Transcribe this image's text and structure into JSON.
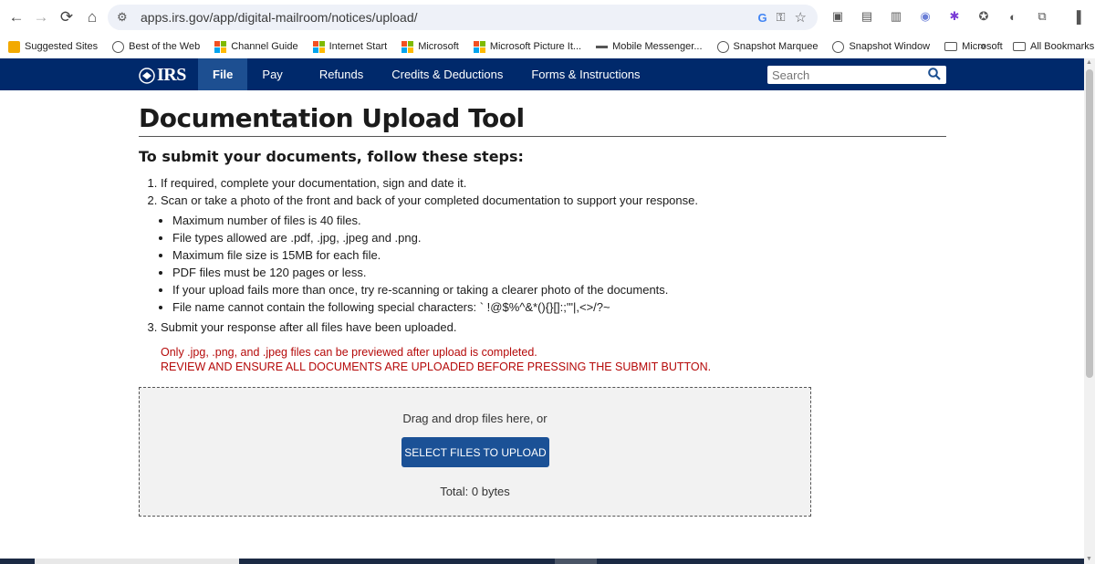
{
  "browser": {
    "url": "apps.irs.gov/app/digital-mailroom/notices/upload/",
    "bookmarks": [
      {
        "label": "Suggested Sites",
        "icon": "bing-icon"
      },
      {
        "label": "Best of the Web",
        "icon": "globe-icon"
      },
      {
        "label": "Channel Guide",
        "icon": "microsoft-icon"
      },
      {
        "label": "Internet Start",
        "icon": "microsoft-icon"
      },
      {
        "label": "Microsoft",
        "icon": "microsoft-icon"
      },
      {
        "label": "Microsoft Picture It...",
        "icon": "microsoft-icon"
      },
      {
        "label": "Mobile Messenger...",
        "icon": "messenger-icon"
      },
      {
        "label": "Snapshot Marquee",
        "icon": "globe-icon"
      },
      {
        "label": "Snapshot Window",
        "icon": "globe-icon"
      },
      {
        "label": "Microsoft",
        "icon": "folder-icon"
      }
    ],
    "overflow_chevron": "»",
    "all_bookmarks": "All Bookmarks"
  },
  "irs": {
    "logo": "IRS",
    "nav": [
      {
        "label": "File",
        "active": true
      },
      {
        "label": "Pay",
        "active": false
      },
      {
        "label": "Refunds",
        "active": false
      },
      {
        "label": "Credits & Deductions",
        "active": false
      },
      {
        "label": "Forms & Instructions",
        "active": false
      }
    ],
    "search_placeholder": "Search"
  },
  "page": {
    "title": "Documentation Upload Tool",
    "subtitle": "To submit your documents, follow these steps:",
    "step1": "If required, complete your documentation, sign and date it.",
    "step2": "Scan or take a photo of the front and back of your completed documentation to support your response.",
    "bullets": [
      "Maximum number of files is 40 files.",
      "File types allowed are .pdf, .jpg, .jpeg and .png.",
      "Maximum file size is 15MB for each file.",
      "PDF files must be 120 pages or less.",
      "If your upload fails more than once, try re-scanning or taking a clearer photo of the documents.",
      "File name cannot contain the following special characters: ` !@$%^&*(){}[]:;'\"|,<>/?~"
    ],
    "step3": "Submit your response after all files have been uploaded.",
    "notice_line1": "Only .jpg, .png, and .jpeg files can be previewed after upload is completed.",
    "notice_line2": "REVIEW AND ENSURE ALL DOCUMENTS ARE UPLOADED BEFORE PRESSING THE SUBMIT BUTTON."
  },
  "dropzone": {
    "prompt": "Drag and drop files here, or",
    "button_label": "SELECT FILES TO UPLOAD",
    "total": "Total: 0 bytes"
  },
  "colors": {
    "irs_navy": "#00296b",
    "nav_active": "#1d4f91",
    "button_blue": "#1b5196",
    "notice_red": "#b50909"
  }
}
